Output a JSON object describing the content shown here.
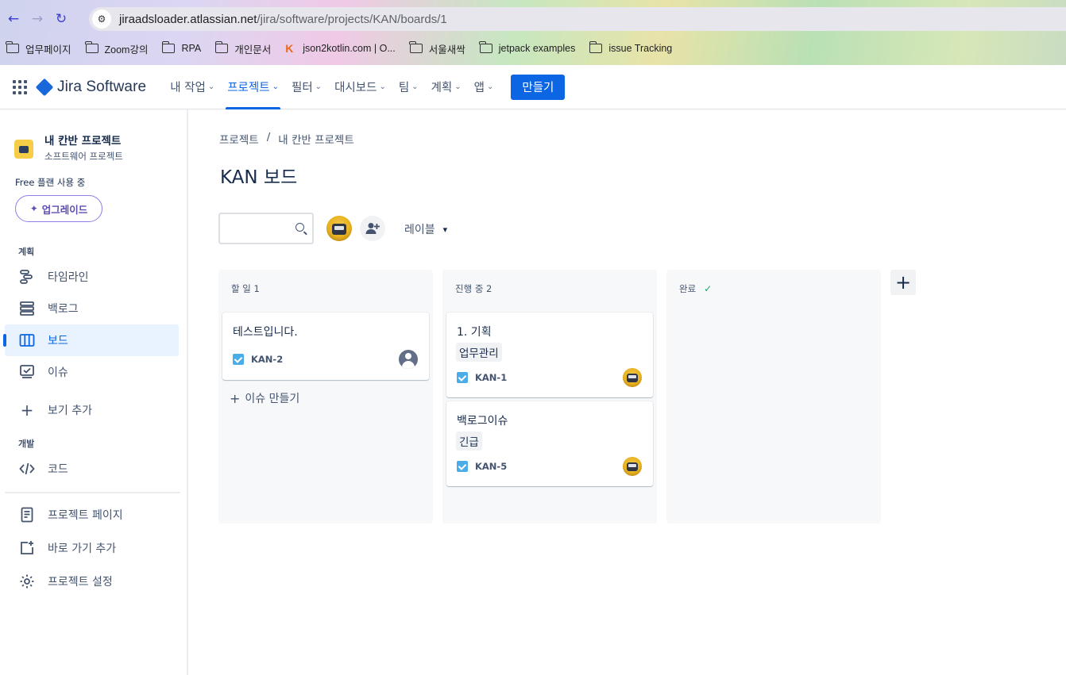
{
  "browser": {
    "url_host": "jiraadsloader.atlassian.net",
    "url_path": "/jira/software/projects/KAN/boards/1",
    "bookmarks": [
      "업무페이지",
      "Zoom강의",
      "RPA",
      "개인문서",
      "json2kotlin.com | O...",
      "서울새싹",
      "jetpack examples",
      "issue Tracking"
    ]
  },
  "topnav": {
    "product": "Jira Software",
    "items": [
      "내 작업",
      "프로젝트",
      "필터",
      "대시보드",
      "팀",
      "계획",
      "앱"
    ],
    "active_index": 1,
    "create_label": "만들기"
  },
  "sidebar": {
    "project_name": "내 칸반 프로젝트",
    "project_type": "소프트웨어 프로젝트",
    "plan_text": "Free 플랜 사용 중",
    "upgrade_label": "업그레이드",
    "section_plan": "계획",
    "section_dev": "개발",
    "items": {
      "timeline": "타임라인",
      "backlog": "백로그",
      "board": "보드",
      "issues": "이슈",
      "add_view": "보기 추가",
      "code": "코드",
      "project_pages": "프로젝트 페이지",
      "add_shortcut": "바로 가기 추가",
      "project_settings": "프로젝트 설정"
    }
  },
  "main": {
    "breadcrumb": [
      "프로젝트",
      "내 칸반 프로젝트"
    ],
    "title": "KAN 보드",
    "search_placeholder": "",
    "label_filter": "레이블"
  },
  "board": {
    "columns": [
      {
        "name": "할 일 1",
        "cards": [
          {
            "title": "테스트입니다.",
            "key": "KAN-2",
            "label": "",
            "assignee": "unassigned"
          }
        ],
        "create_issue": "이슈 만들기"
      },
      {
        "name": "진행 중 2",
        "cards": [
          {
            "title": "1. 기획",
            "label": "업무관리",
            "key": "KAN-1",
            "assignee": "user"
          },
          {
            "title": "백로그이슈",
            "label": "긴급",
            "key": "KAN-5",
            "assignee": "user"
          }
        ]
      },
      {
        "name": "완료",
        "done": true,
        "cards": []
      }
    ]
  }
}
